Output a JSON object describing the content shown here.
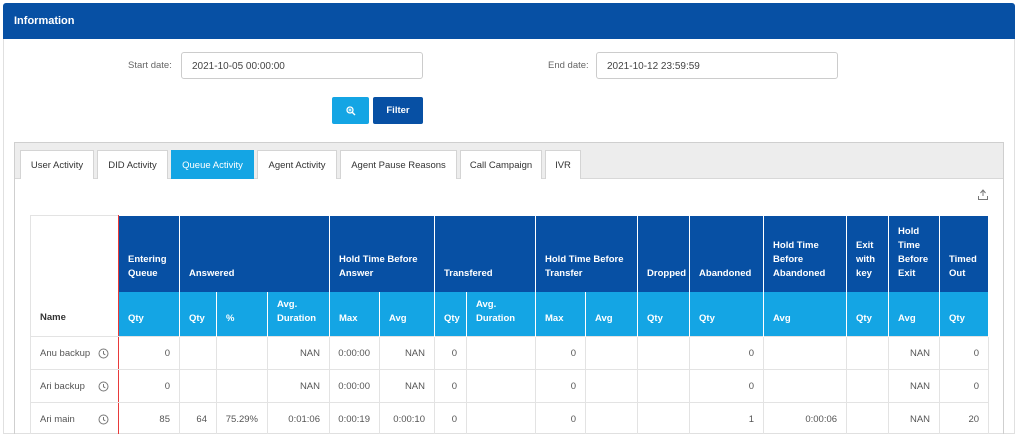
{
  "header": {
    "title": "Information"
  },
  "filters": {
    "start_label": "Start date:",
    "start_value": "2021-10-05 00:00:00",
    "end_label": "End date:",
    "end_value": "2021-10-12 23:59:59",
    "filter_button": "Filter"
  },
  "tabs": [
    "User Activity",
    "DID Activity",
    "Queue Activity",
    "Agent Activity",
    "Agent Pause Reasons",
    "Call Campaign",
    "IVR"
  ],
  "active_tab": "Queue Activity",
  "colors": {
    "header": "#0750a4",
    "accent": "#14a5e4",
    "divider": "#e83a3a"
  },
  "icons": {
    "zoom": "magnifier-plus-icon",
    "export": "export-icon",
    "clock": "clock-icon"
  },
  "table": {
    "name_header": "Name",
    "group_headers": [
      "Entering Queue",
      "Answered",
      "Hold Time Before Answer",
      "Transfered",
      "Hold Time Before Transfer",
      "Dropped",
      "Abandoned",
      "Hold Time Before Abandoned",
      "Exit with key",
      "Hold Time Before Exit",
      "Timed Out"
    ],
    "sub_headers": [
      "Qty",
      "Qty",
      "%",
      "Avg. Duration",
      "Max",
      "Avg",
      "Qty",
      "Avg. Duration",
      "Max",
      "Avg",
      "Qty",
      "Qty",
      "Avg",
      "Qty",
      "Avg",
      "Qty"
    ],
    "rows": [
      {
        "name": "Anu backup",
        "cells": [
          "0",
          "",
          "",
          "NAN",
          "0:00:00",
          "NAN",
          "0",
          "",
          "0",
          "",
          "",
          "0",
          "",
          "",
          "NAN",
          "0"
        ]
      },
      {
        "name": "Ari backup",
        "cells": [
          "0",
          "",
          "",
          "NAN",
          "0:00:00",
          "NAN",
          "0",
          "",
          "0",
          "",
          "",
          "0",
          "",
          "",
          "NAN",
          "0"
        ]
      },
      {
        "name": "Ari main",
        "cells": [
          "85",
          "64",
          "75.29%",
          "0:01:06",
          "0:00:19",
          "0:00:10",
          "0",
          "",
          "0",
          "",
          "",
          "1",
          "0:00:06",
          "",
          "NAN",
          "20"
        ]
      }
    ]
  }
}
